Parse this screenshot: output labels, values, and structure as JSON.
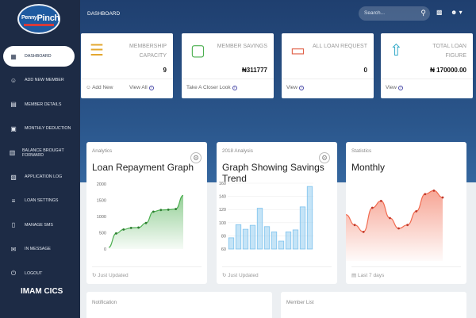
{
  "brand": {
    "word1": "Penny",
    "word2": "Pinch"
  },
  "org_name": "IMAM CICS",
  "nav": [
    {
      "label": "Dashboard",
      "icon": "dashboard-icon",
      "glyph": "▦",
      "active": true
    },
    {
      "label": "Add New Member",
      "icon": "user-icon",
      "glyph": "☺",
      "active": false
    },
    {
      "label": "Member Details",
      "icon": "building-icon",
      "glyph": "▤",
      "active": false
    },
    {
      "label": "Monthly Deduction",
      "icon": "calculator-icon",
      "glyph": "▣",
      "active": false
    },
    {
      "label": "Balance Brought Forward",
      "icon": "ledger-icon",
      "glyph": "▥",
      "active": false
    },
    {
      "label": "Application Log",
      "icon": "log-icon",
      "glyph": "▧",
      "active": false
    },
    {
      "label": "Loan Settings",
      "icon": "settings-icon",
      "glyph": "≡",
      "active": false
    },
    {
      "label": "Manage SMS",
      "icon": "phone-icon",
      "glyph": "▯",
      "active": false
    },
    {
      "label": "In Message",
      "icon": "message-icon",
      "glyph": "✉",
      "active": false
    },
    {
      "label": "Logout",
      "icon": "logout-icon",
      "glyph": "⏻",
      "active": false
    }
  ],
  "header": {
    "breadcrumb": "DASHBOARD",
    "search_placeholder": "Search..."
  },
  "stats": [
    {
      "title": "Membership Capacity",
      "value": "9",
      "icon": "database-icon",
      "glyph": "☰",
      "color": "#e3a72f",
      "foot_left": "Add New",
      "foot_right": "View All"
    },
    {
      "title": "Member Savings",
      "value": "₦311777",
      "icon": "wallet-icon",
      "glyph": "▢",
      "color": "#4caf50",
      "foot_left": "Take A Closer Look",
      "foot_right": ""
    },
    {
      "title": "All Loan Request",
      "value": "0",
      "icon": "card-icon",
      "glyph": "▭",
      "color": "#e0624a",
      "foot_left": "View",
      "foot_right": ""
    },
    {
      "title": "Total Loan Figure",
      "value": "₦ 170000.00",
      "icon": "share-icon",
      "glyph": "⇧",
      "color": "#31a9c8",
      "foot_left": "View",
      "foot_right": ""
    }
  ],
  "cards": [
    {
      "category": "Analytics",
      "title": "Loan Repayment Graph",
      "footer": "Just Updated"
    },
    {
      "category": "2018 Analysis",
      "title": "Graph Showing Savings Trend",
      "footer": "Just Updated"
    },
    {
      "category": "Statistics",
      "title": "Monthly",
      "footer": "Last 7 days"
    }
  ],
  "bottom": [
    {
      "title": "Notification"
    },
    {
      "title": "Member List"
    }
  ],
  "chart_data": [
    {
      "type": "area",
      "title": "Loan Repayment Graph",
      "ylim": [
        0,
        2000
      ],
      "yticks": [
        0,
        500,
        1000,
        1500,
        2000
      ],
      "x": [
        0,
        1,
        2,
        3,
        4,
        5,
        6,
        7,
        8,
        9,
        10
      ],
      "values": [
        50,
        480,
        600,
        650,
        660,
        800,
        1150,
        1200,
        1210,
        1230,
        1650
      ],
      "color": "#4caf50"
    },
    {
      "type": "bar",
      "title": "Graph Showing Savings Trend",
      "ylim": [
        60,
        160
      ],
      "yticks": [
        60,
        80,
        100,
        120,
        140,
        160
      ],
      "values": [
        77,
        97,
        90,
        96,
        122,
        94,
        86,
        72,
        86,
        89,
        124,
        155
      ],
      "color": "#7ec3ee"
    },
    {
      "type": "area",
      "title": "Monthly",
      "values": [
        50,
        35,
        25,
        60,
        70,
        45,
        30,
        35,
        55,
        80,
        85,
        75
      ],
      "color": "#f16a4f"
    }
  ]
}
